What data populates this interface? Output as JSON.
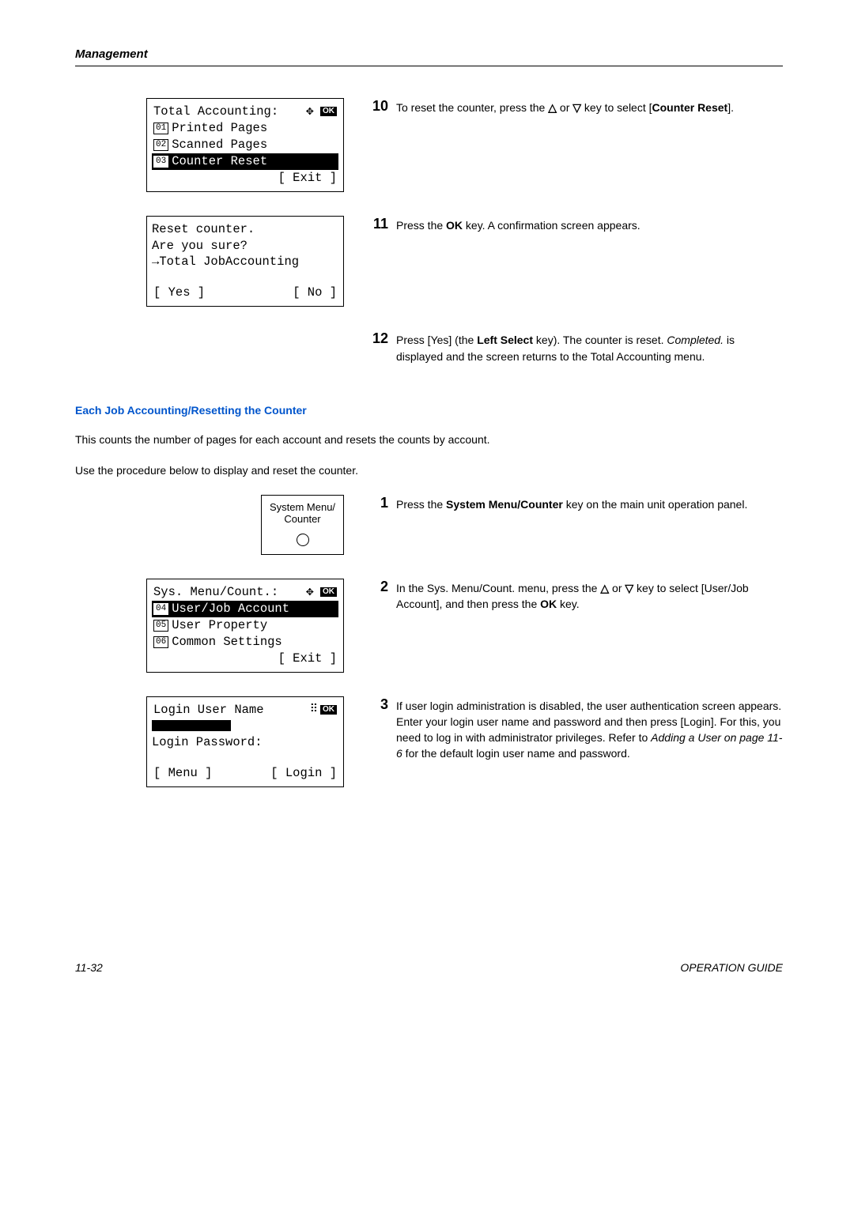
{
  "header": {
    "title": "Management"
  },
  "lcd1": {
    "title": "Total Accounting:",
    "items": [
      {
        "num": "01",
        "label": "Printed Pages"
      },
      {
        "num": "02",
        "label": "Scanned Pages"
      },
      {
        "num": "03",
        "label": "Counter Reset"
      }
    ],
    "softkey": "[  Exit   ]"
  },
  "step10": {
    "num": "10",
    "text_a": "To reset the counter, press the ",
    "text_b": " or ",
    "text_c": " key to select [",
    "bold": "Counter Reset",
    "text_d": "]."
  },
  "lcd2": {
    "line1": "Reset counter.",
    "line2": "Are you sure?",
    "arrow": "→",
    "line3": "Total JobAccounting",
    "soft_left": "[  Yes   ]",
    "soft_right": "[   No   ]"
  },
  "step11": {
    "num": "11",
    "text_a": "Press the ",
    "bold": "OK",
    "text_b": " key. A confirmation screen appears."
  },
  "step12": {
    "num": "12",
    "text_a": "Press [Yes] (the ",
    "bold_a": "Left Select",
    "text_b": " key). The counter is reset. ",
    "italic": "Completed.",
    "text_c": " is displayed and the screen returns to the Total Accounting menu."
  },
  "section_heading": "Each Job Accounting/Resetting the Counter",
  "para1": "This counts the number of pages for each account and resets the counts by account.",
  "para2": "Use the procedure below to display and reset the counter.",
  "button_box": {
    "line1": "System Menu/",
    "line2": "Counter"
  },
  "step1": {
    "num": "1",
    "text_a": "Press the ",
    "bold": "System Menu/Counter",
    "text_b": " key on the main unit operation panel."
  },
  "lcd3": {
    "title": "Sys. Menu/Count.:",
    "items": [
      {
        "num": "04",
        "label": "User/Job Account"
      },
      {
        "num": "05",
        "label": "User Property"
      },
      {
        "num": "06",
        "label": "Common Settings"
      }
    ],
    "softkey": "[  Exit   ]"
  },
  "step2": {
    "num": "2",
    "text_a": "In the Sys. Menu/Count. menu, press the ",
    "text_b": " or ",
    "text_c": " key to select [User/Job Account], and then press the ",
    "bold": "OK",
    "text_d": " key."
  },
  "lcd4": {
    "line1": "Login User Name",
    "line2": "Login Password:",
    "soft_left": "[  Menu  ]",
    "soft_right": "[  Login  ]"
  },
  "step3": {
    "num": "3",
    "text_a": "If user login administration is disabled, the user authentication screen appears. Enter your login user name and password and then press [Login]. For this, you need to log in with administrator privileges. Refer to ",
    "italic": "Adding a User on page 11-6",
    "text_b": " for the default login user name and password."
  },
  "footer": {
    "left": "11-32",
    "right": "OPERATION GUIDE"
  }
}
